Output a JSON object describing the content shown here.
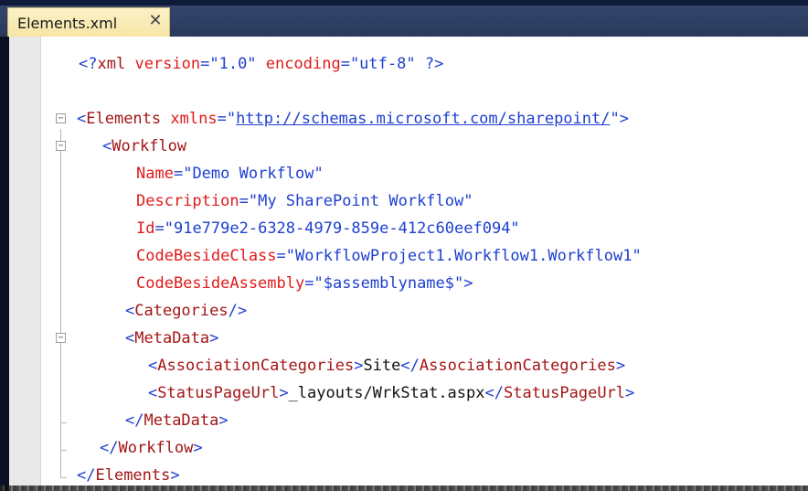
{
  "tab": {
    "title": "Elements.xml",
    "close_glyph": "✕",
    "close_icon": "close-icon"
  },
  "colors": {
    "tag": "#a31515",
    "attribute": "#e01a1a",
    "value": "#1f3fcf",
    "punctuation": "#1f3fcf",
    "text": "#111111"
  },
  "code": {
    "l1": {
      "open": "<?",
      "tag": "xml",
      "a1": "version",
      "eq1": "=",
      "v1": "\"1.0\"",
      "a2": "encoding",
      "eq2": "=",
      "v2": "\"utf-8\"",
      "close": "?>"
    },
    "l2": {
      "open": "<",
      "tag": "Elements",
      "a1": "xmlns",
      "eq1": "=",
      "q1": "\"",
      "url": "http://schemas.microsoft.com/sharepoint/",
      "q2": "\"",
      "close": ">"
    },
    "l3": {
      "open": "<",
      "tag": "Workflow"
    },
    "l4": {
      "attr": "Name",
      "eq": "=",
      "val": "\"Demo Workflow\""
    },
    "l5": {
      "attr": "Description",
      "eq": "=",
      "val": "\"My SharePoint Workflow\""
    },
    "l6": {
      "attr": "Id",
      "eq": "=",
      "val": "\"91e779e2-6328-4979-859e-412c60eef094\""
    },
    "l7": {
      "attr": "CodeBesideClass",
      "eq": "=",
      "val": "\"WorkflowProject1.Workflow1.Workflow1\""
    },
    "l8": {
      "attr": "CodeBesideAssembly",
      "eq": "=",
      "val": "\"$assemblyname$\"",
      "close": ">"
    },
    "l9": {
      "open": "<",
      "tag": "Categories",
      "close": "/>"
    },
    "l10": {
      "open": "<",
      "tag": "MetaData",
      "close": ">"
    },
    "l11": {
      "open": "<",
      "tag": "AssociationCategories",
      "close": ">",
      "text": "Site",
      "open2": "</",
      "tag2": "AssociationCategories",
      "close2": ">"
    },
    "l12": {
      "open": "<",
      "tag": "StatusPageUrl",
      "close": ">",
      "text": "_layouts/WrkStat.aspx",
      "open2": "</",
      "tag2": "StatusPageUrl",
      "close2": ">"
    },
    "l13": {
      "open": "</",
      "tag": "MetaData",
      "close": ">"
    },
    "l14": {
      "open": "</",
      "tag": "Workflow",
      "close": ">"
    },
    "l15": {
      "open": "</",
      "tag": "Elements",
      "close": ">"
    }
  },
  "fold_markers": {
    "collapse": "−"
  }
}
